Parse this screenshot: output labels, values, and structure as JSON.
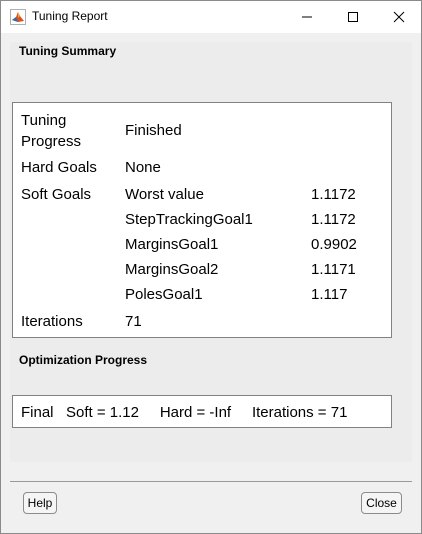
{
  "window": {
    "title": "Tuning Report",
    "accent_color": "#d9531e"
  },
  "summary": {
    "title": "Tuning Summary",
    "tuning_progress": {
      "label_line1": "Tuning",
      "label_line2": "Progress",
      "value": "Finished"
    },
    "hard_goals": {
      "label": "Hard Goals",
      "value": "None"
    },
    "soft_goals": {
      "label": "Soft Goals",
      "rows": [
        {
          "name": "Worst value",
          "value": "1.1172"
        },
        {
          "name": "StepTrackingGoal1",
          "value": "1.1172"
        },
        {
          "name": "MarginsGoal1",
          "value": "0.9902"
        },
        {
          "name": "MarginsGoal2",
          "value": "1.1171"
        },
        {
          "name": "PolesGoal1",
          "value": "1.117"
        }
      ]
    },
    "iterations": {
      "label": "Iterations",
      "value": "71"
    }
  },
  "optimization": {
    "title": "Optimization Progress",
    "text": "Final   Soft = 1.12     Hard = -Inf     Iterations = 71"
  },
  "buttons": {
    "help": "Help",
    "close": "Close"
  }
}
